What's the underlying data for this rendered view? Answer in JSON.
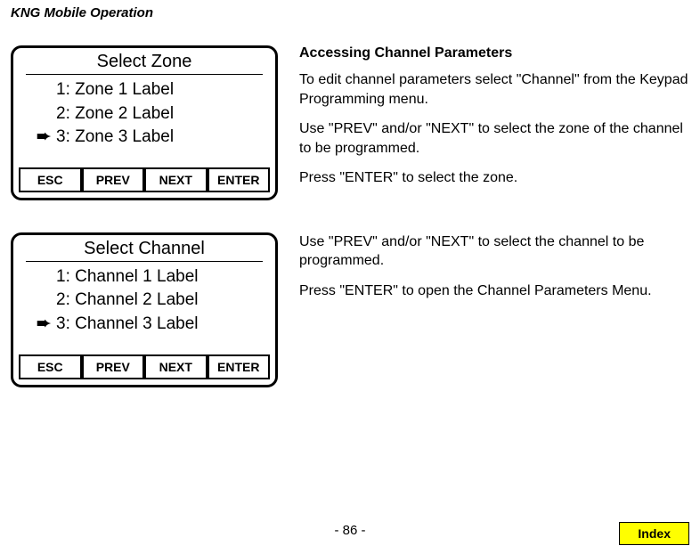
{
  "page_header": "KNG Mobile Operation",
  "screen1": {
    "title": "Select Zone",
    "items": [
      {
        "label": "1: Zone 1 Label",
        "selected": false
      },
      {
        "label": "2: Zone 2 Label",
        "selected": false
      },
      {
        "label": "3: Zone 3 Label",
        "selected": true
      }
    ],
    "buttons": {
      "esc": "ESC",
      "prev": "PREV",
      "next": "NEXT",
      "enter": "ENTER"
    }
  },
  "text1": {
    "heading": "Accessing Channel Parameters",
    "p1": "To edit channel parameters select \"Channel\" from the Keypad Programming menu.",
    "p2": "Use \"PREV\" and/or \"NEXT\" to select the zone of the channel to be programmed.",
    "p3": "Press \"ENTER\" to select the zone."
  },
  "screen2": {
    "title": "Select Channel",
    "items": [
      {
        "label": "1: Channel 1 Label",
        "selected": false
      },
      {
        "label": "2: Channel 2 Label",
        "selected": false
      },
      {
        "label": "3: Channel 3 Label",
        "selected": true
      }
    ],
    "buttons": {
      "esc": "ESC",
      "prev": "PREV",
      "next": "NEXT",
      "enter": "ENTER"
    }
  },
  "text2": {
    "p1": "Use \"PREV\" and/or \"NEXT\" to select the channel to be programmed.",
    "p2": "Press \"ENTER\" to open the Channel Parameters Menu."
  },
  "page_number": "- 86 -",
  "index_label": "Index",
  "pointer_glyph": "➨"
}
